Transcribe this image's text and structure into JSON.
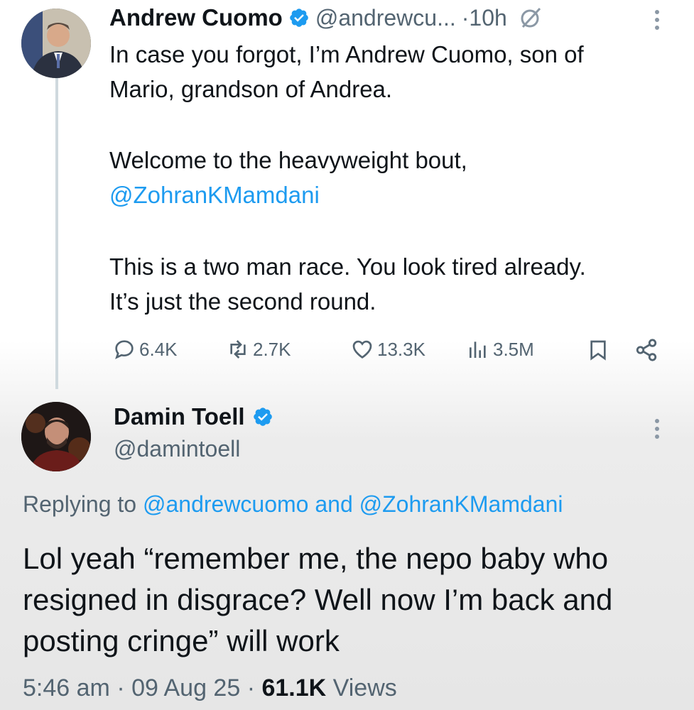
{
  "tweet": {
    "author_name": "Andrew Cuomo",
    "handle": "@andrewcu...",
    "time": "·10h",
    "lines": [
      "In case you forgot, I’m Andrew Cuomo, son of",
      "Mario, grandson of Andrea."
    ],
    "paragraph2_text": "Welcome to the heavyweight bout,",
    "mention": "@ZohranKMamdani",
    "paragraph3_lines": [
      "This is a two man race. You look tired already.",
      "It’s just the second round."
    ],
    "stats": {
      "replies": "6.4K",
      "retweets": "2.7K",
      "likes": "13.3K",
      "views": "3.5M"
    }
  },
  "reply": {
    "author_name": "Damin Toell",
    "handle": "@damintoell",
    "replying_prefix": "Replying to",
    "replying_user1": "@andrewcuomo",
    "replying_and": "and",
    "replying_user2": "@ZohranKMamdani",
    "lines": [
      "Lol yeah “remember me, the nepo baby who",
      "resigned in disgrace? Well now I’m back and",
      "posting cringe” will work"
    ],
    "time": "5:46 am",
    "sep1": "·",
    "date": "09 Aug 25",
    "sep2": "·",
    "views_count": "61.1K",
    "views_label": "Views"
  },
  "colors": {
    "link": "#1d9bf0",
    "verified": "#1d9bf0",
    "muted": "#536471"
  },
  "icons": [
    "verified-badge-icon",
    "grok-icon",
    "more-icon",
    "reply-icon",
    "retweet-icon",
    "like-icon",
    "views-icon",
    "bookmark-icon",
    "share-icon"
  ]
}
